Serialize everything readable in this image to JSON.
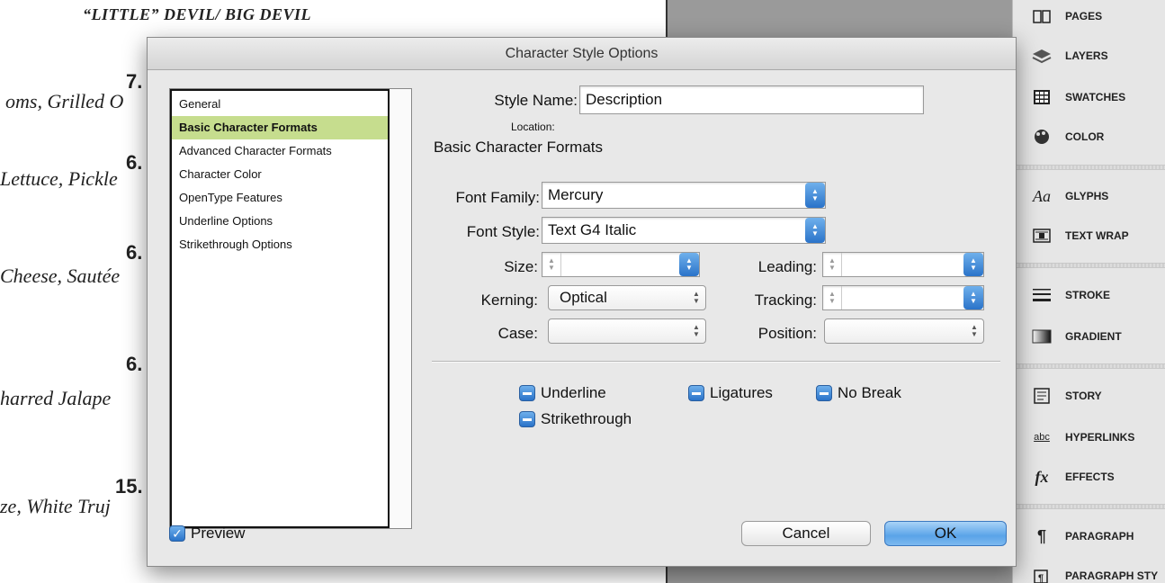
{
  "document": {
    "title": "“LITTLE” DEVIL/ BIG DEVIL",
    "items": [
      {
        "price": "7.",
        "desc": "oms, Grilled O"
      },
      {
        "price": "6.",
        "desc": "Lettuce, Pickle"
      },
      {
        "price": "6.",
        "desc": "Cheese, Sautée"
      },
      {
        "price": "6.",
        "desc": "harred Jalape"
      },
      {
        "price": "15.",
        "desc": "ze, White Truj"
      }
    ]
  },
  "panels": [
    {
      "label": "PAGES",
      "icon": "pages-icon"
    },
    {
      "label": "LAYERS",
      "icon": "layers-icon"
    },
    {
      "label": "SWATCHES",
      "icon": "swatches-icon"
    },
    {
      "label": "COLOR",
      "icon": "color-icon"
    },
    {
      "label": "GLYPHS",
      "icon": "glyphs-icon",
      "glyph": "Aa"
    },
    {
      "label": "TEXT WRAP",
      "icon": "text-wrap-icon"
    },
    {
      "label": "STROKE",
      "icon": "stroke-icon"
    },
    {
      "label": "GRADIENT",
      "icon": "gradient-icon"
    },
    {
      "label": "STORY",
      "icon": "story-icon"
    },
    {
      "label": "HYPERLINKS",
      "icon": "hyperlinks-icon",
      "glyph": "abc"
    },
    {
      "label": "EFFECTS",
      "icon": "effects-icon",
      "glyph": "fx"
    },
    {
      "label": "PARAGRAPH",
      "icon": "paragraph-icon",
      "glyph": "¶"
    },
    {
      "label": "PARAGRAPH STY",
      "icon": "paragraph-styles-icon"
    }
  ],
  "dialog": {
    "title": "Character Style Options",
    "categories": [
      "General",
      "Basic Character Formats",
      "Advanced Character Formats",
      "Character Color",
      "OpenType Features",
      "Underline Options",
      "Strikethrough Options"
    ],
    "selected_category": "Basic Character Formats",
    "style_name_label": "Style Name:",
    "style_name_value": "Description",
    "location_label": "Location:",
    "section_title": "Basic Character Formats",
    "font_family_label": "Font Family:",
    "font_family_value": "Mercury",
    "font_style_label": "Font Style:",
    "font_style_value": "Text G4 Italic",
    "size_label": "Size:",
    "size_value": "",
    "leading_label": "Leading:",
    "leading_value": "",
    "kerning_label": "Kerning:",
    "kerning_value": "Optical",
    "tracking_label": "Tracking:",
    "tracking_value": "",
    "case_label": "Case:",
    "case_value": "",
    "position_label": "Position:",
    "position_value": "",
    "underline_label": "Underline",
    "ligatures_label": "Ligatures",
    "no_break_label": "No Break",
    "strikethrough_label": "Strikethrough",
    "preview_label": "Preview",
    "preview_checked": true,
    "cancel_label": "Cancel",
    "ok_label": "OK"
  },
  "colors": {
    "selection": "#c6dd8e",
    "accent_blue": "#2a73c9"
  }
}
